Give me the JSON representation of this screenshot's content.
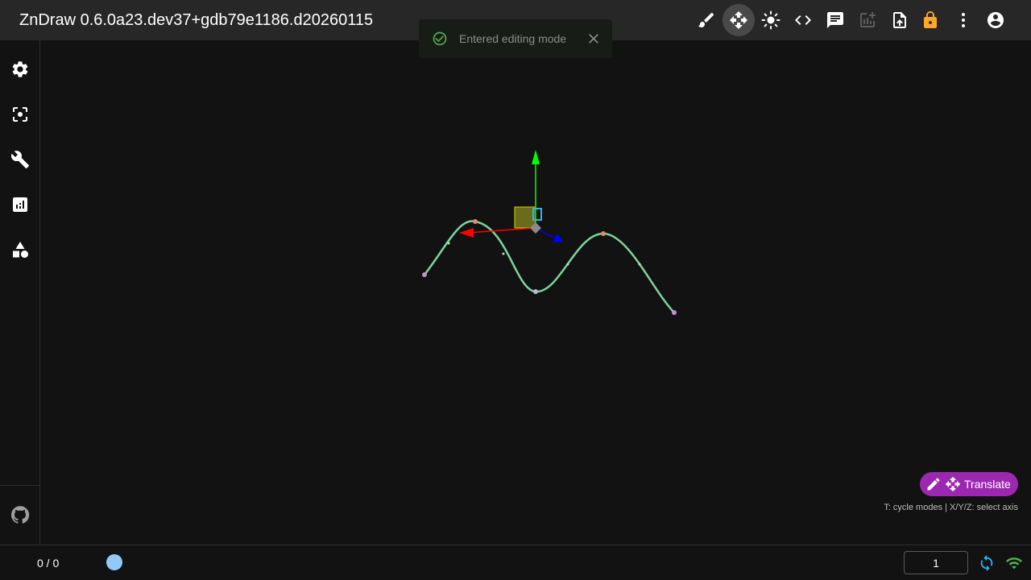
{
  "app": {
    "title": "ZnDraw 0.6.0a23.dev37+gdb79e1186.d20260115"
  },
  "toolbar": {
    "items": [
      {
        "icon": "brush-icon",
        "tooltip": ""
      },
      {
        "icon": "move-icon",
        "active": true
      },
      {
        "icon": "brightness-icon"
      },
      {
        "icon": "code-icon"
      },
      {
        "icon": "chat-icon"
      },
      {
        "icon": "add-chart-icon",
        "disabled": true
      },
      {
        "icon": "upload-file-icon"
      },
      {
        "icon": "lock-icon",
        "color": "#ffa726"
      },
      {
        "icon": "more-vert-icon"
      },
      {
        "icon": "account-icon"
      }
    ]
  },
  "sidebar": {
    "items": [
      "gear-icon",
      "center-focus-icon",
      "wrench-icon",
      "analytics-icon",
      "shapes-icon"
    ],
    "footer": "github-icon"
  },
  "toast": {
    "message": "Entered editing mode",
    "icon": "check-circle-icon",
    "color": "#4caf50"
  },
  "editor": {
    "mode_label": "Translate",
    "pill_color": "#9c27b0",
    "hint": "T: cycle modes | X/Y/Z: select axis"
  },
  "footer": {
    "frame_count": "0 / 0",
    "frame_input_value": "1",
    "slider_color": "#90caf9",
    "connection_color": "#4caf50"
  },
  "colors": {
    "curve": "#7dd3a0",
    "accent": "#9c27b0",
    "x_axis": "#ff0000",
    "y_axis": "#00ff00",
    "z_axis": "#0000ff"
  }
}
